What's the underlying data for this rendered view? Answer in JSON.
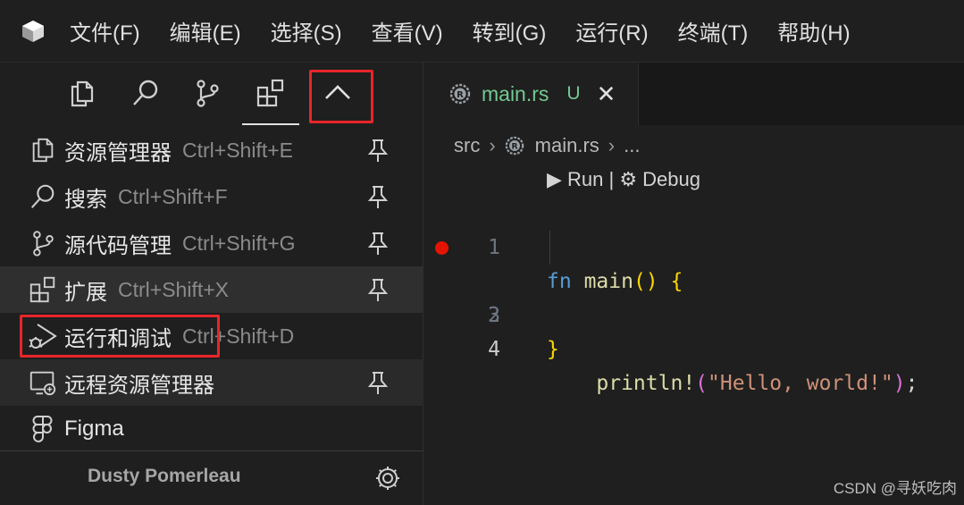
{
  "menubar": {
    "items": [
      "文件(F)",
      "编辑(E)",
      "选择(S)",
      "查看(V)",
      "转到(G)",
      "运行(R)",
      "终端(T)",
      "帮助(H)"
    ]
  },
  "activity_tabs": [
    "explorer-icon",
    "search-icon",
    "source-control-icon",
    "extensions-icon",
    "chevron-up-icon"
  ],
  "views": [
    {
      "label": "资源管理器",
      "shortcut": "Ctrl+Shift+E",
      "icon": "files-icon",
      "pinned": true
    },
    {
      "label": "搜索",
      "shortcut": "Ctrl+Shift+F",
      "icon": "search-icon",
      "pinned": true
    },
    {
      "label": "源代码管理",
      "shortcut": "Ctrl+Shift+G",
      "icon": "source-control-icon",
      "pinned": true
    },
    {
      "label": "扩展",
      "shortcut": "Ctrl+Shift+X",
      "icon": "extensions-icon",
      "pinned": true
    },
    {
      "label": "运行和调试",
      "shortcut": "Ctrl+Shift+D",
      "icon": "run-debug-icon",
      "pinned": false
    },
    {
      "label": "远程资源管理器",
      "shortcut": "",
      "icon": "remote-explorer-icon",
      "pinned": true
    },
    {
      "label": "Figma",
      "shortcut": "",
      "icon": "figma-icon",
      "pinned": false
    }
  ],
  "account": {
    "name": "Dusty Pomerleau"
  },
  "editor": {
    "tab": {
      "name": "main.rs",
      "status": "U",
      "close": "✕"
    },
    "breadcrumb": {
      "folder": "src",
      "file": "main.rs",
      "more": "..."
    },
    "codelens": "▶ Run | ⚙ Debug",
    "lines": [
      {
        "number": "1"
      },
      {
        "number": "2"
      },
      {
        "number": "3"
      },
      {
        "number": "4"
      }
    ],
    "code": {
      "l1_kw": "fn",
      "l1_fn": "main",
      "l1_paren": "()",
      "l1_brace": "{",
      "l2_macro": "println!",
      "l2_open": "(",
      "l2_str": "\"Hello, world!\"",
      "l2_close": ")",
      "l2_semi": ";",
      "l3_brace": "}"
    }
  },
  "colors": {
    "background": "#1f1f1f",
    "highlight_box": "#e8262a",
    "breakpoint": "#e51400",
    "untracked": "#73c991"
  },
  "watermark": "CSDN @寻妖吃肉"
}
